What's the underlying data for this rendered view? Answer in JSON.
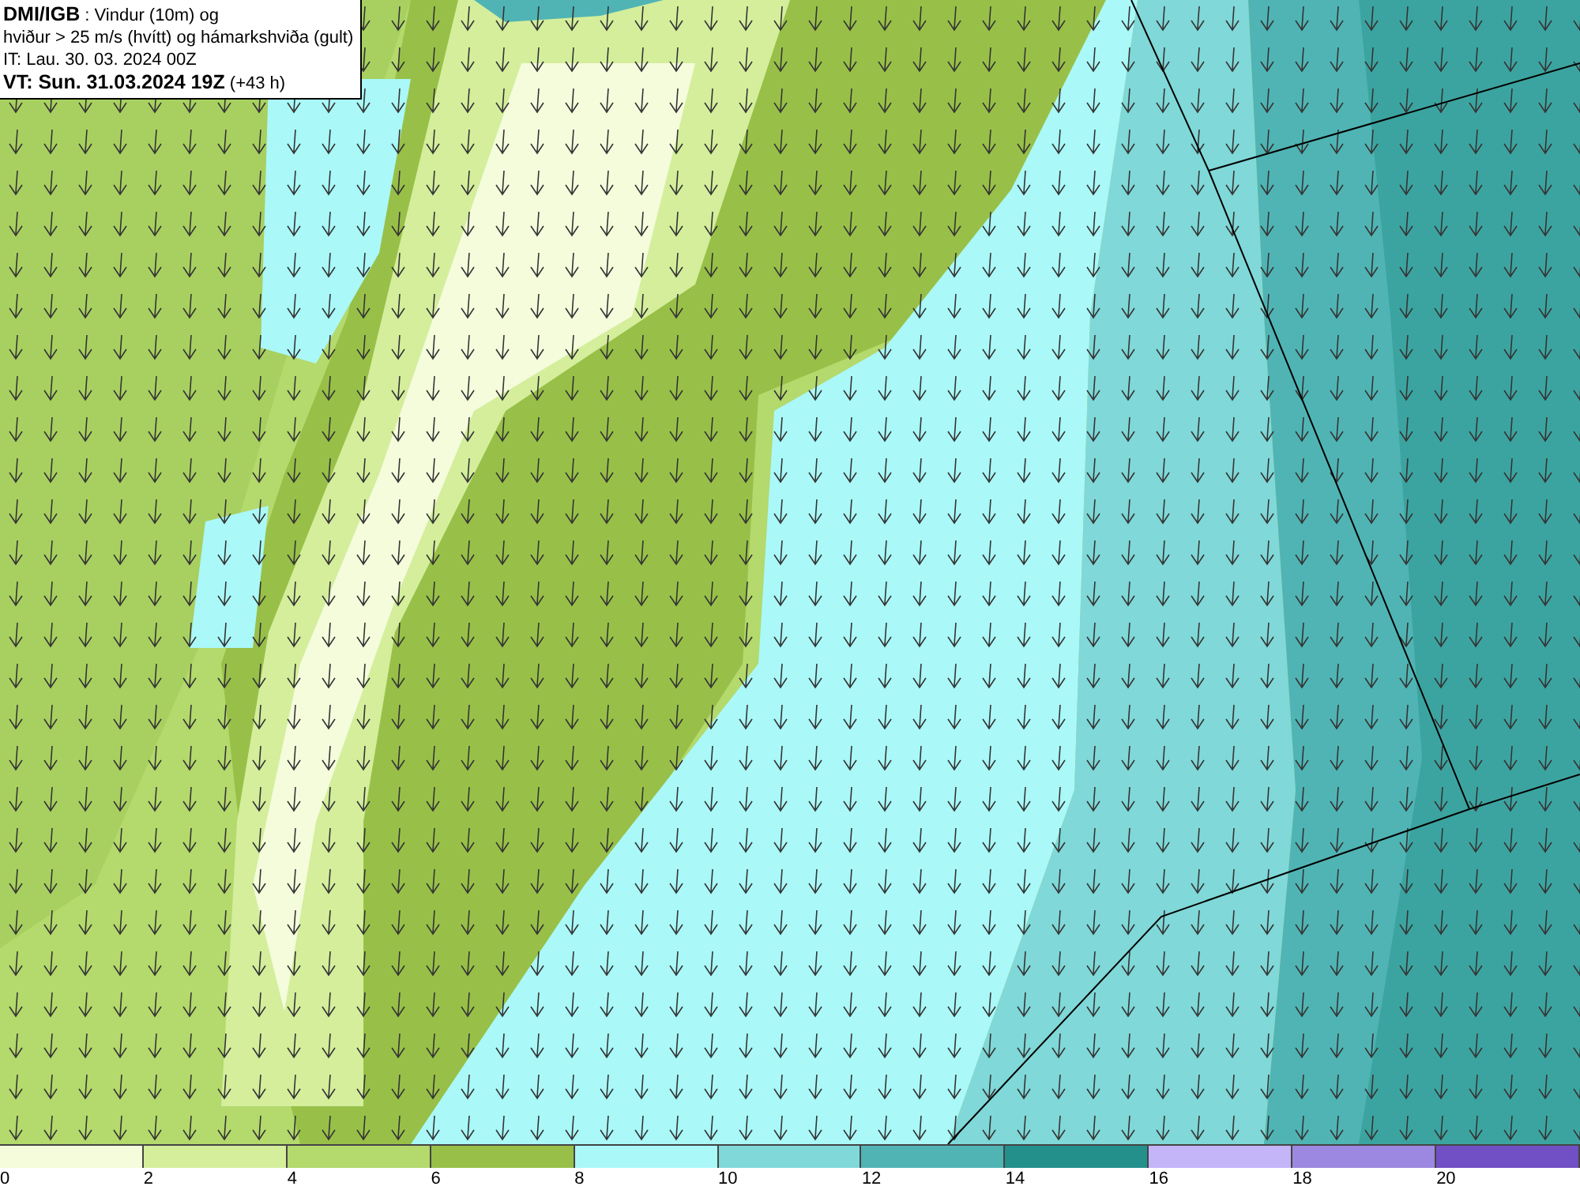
{
  "legend_box": {
    "lines": [
      "**DMI/IGB** : Vindur (10m) og",
      "hviður > 25 m/s (hvítt) og hámarkshviða (gult)",
      "IT: Lau. 30. 03. 2024 00Z",
      "**VT: Sun. 31.03.2024 19Z** (+43 h)"
    ]
  },
  "color_scale": [
    {
      "label": "0",
      "color": "#f4fcdc"
    },
    {
      "label": "2",
      "color": "#d4ee9c"
    },
    {
      "label": "4",
      "color": "#b4d96c"
    },
    {
      "label": "6",
      "color": "#98c048"
    },
    {
      "label": "8",
      "color": "#aaf8f8"
    },
    {
      "label": "10",
      "color": "#80d8d8"
    },
    {
      "label": "12",
      "color": "#50b4b4"
    },
    {
      "label": "14",
      "color": "#24908c"
    },
    {
      "label": "16",
      "color": "#c4b4f8"
    },
    {
      "label": "18",
      "color": "#9c88e0"
    },
    {
      "label": "20",
      "color": "#7050c4"
    }
  ]
}
